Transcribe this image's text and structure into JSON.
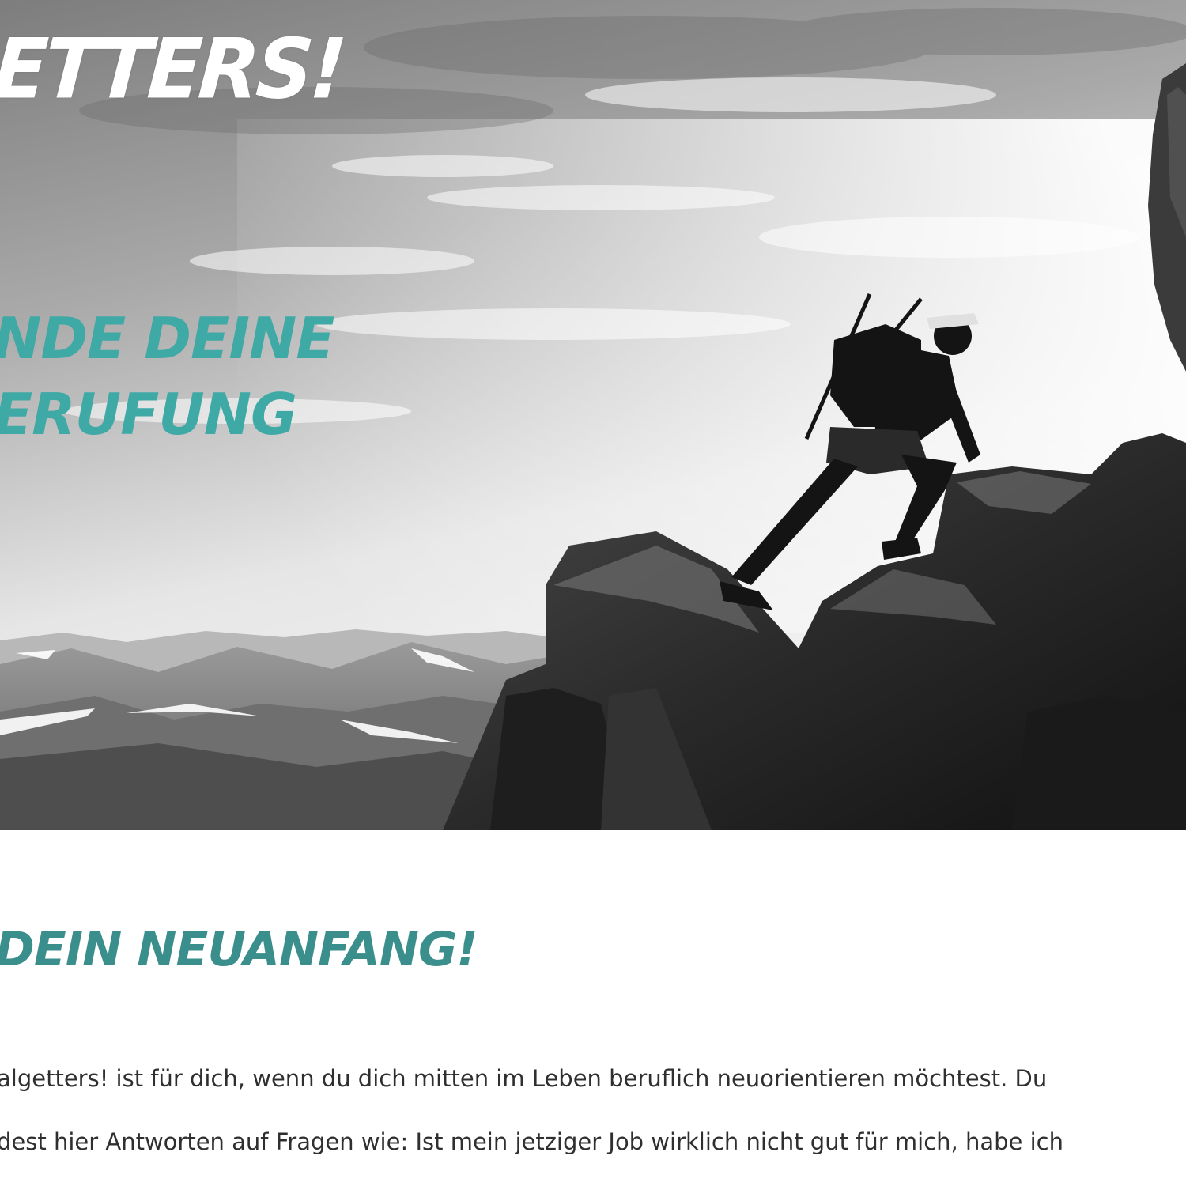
{
  "hero": {
    "brand_title": "ETTERS!",
    "slogan_line1": "NDE DEINE",
    "slogan_line2": "ERUFUNG",
    "image_name": "hiker-on-mountain-rocks"
  },
  "main": {
    "section_heading": "DEIN NEUANFANG!",
    "intro_line1": "algetters! ist für dich, wenn du dich mitten im Leben beruflich neuorientieren möchtest. Du",
    "intro_line2": "dest hier Antworten auf Fragen wie: Ist mein jetziger Job wirklich nicht gut für mich, habe ich"
  },
  "colors": {
    "accent_teal": "#3fa9a6",
    "heading_teal": "#3a8f8c",
    "body_text": "#2f2f2f"
  }
}
